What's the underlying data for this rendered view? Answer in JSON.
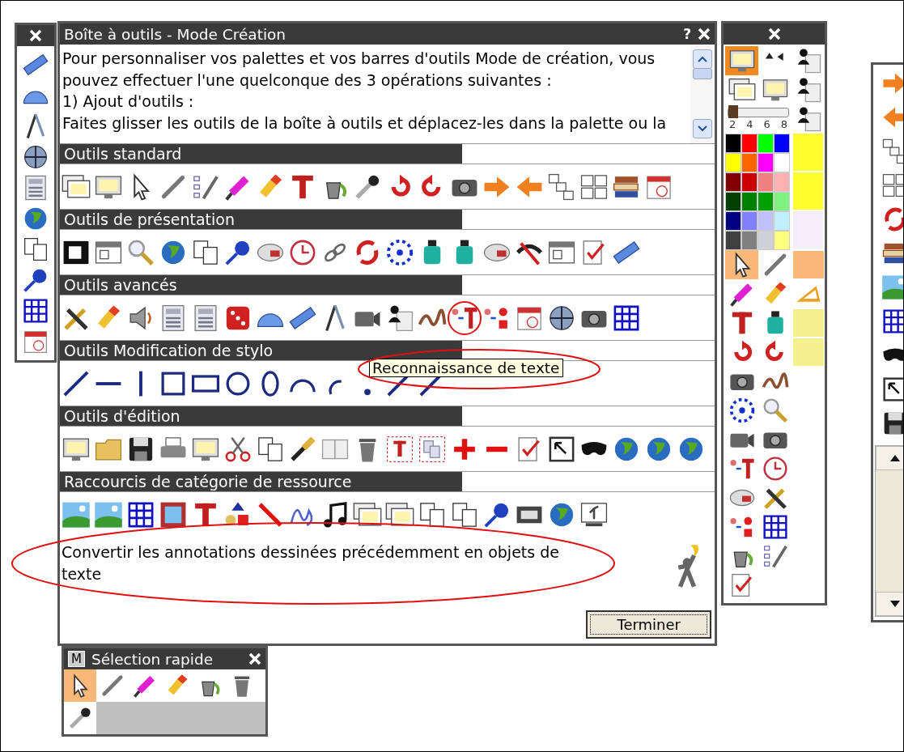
{
  "toolbox": {
    "title": "Boîte à outils - Mode Création",
    "help": "?",
    "intro_lines": [
      "Pour personnaliser vos palettes et vos barres d'outils Mode de création, vous",
      "pouvez effectuer l'une quelconque des 3 opérations suivantes :",
      "1) Ajout d'outils :",
      "Faites glisser les outils de la boîte à outils et déplacez-les dans la palette ou la"
    ],
    "sections": [
      {
        "title": "Outils standard"
      },
      {
        "title": "Outils de présentation"
      },
      {
        "title": "Outils avancés"
      },
      {
        "title": "Outils Modification de stylo"
      },
      {
        "title": "Outils d'édition"
      },
      {
        "title": "Raccourcis de catégorie de ressource"
      }
    ],
    "tooltip": "Reconnaissance de texte",
    "description": "Convertir les annotations dessinées précédemment en objets de\ntexte",
    "button": "Terminer"
  },
  "pen_palette": {
    "mode_button": {
      "selected": true
    },
    "width_slider": {
      "level": 0,
      "labels": [
        "2",
        "4",
        "6",
        "8"
      ]
    },
    "swatches": [
      {
        "color": "#000000"
      },
      {
        "color": "#ff0000"
      },
      {
        "color": "#00ff00"
      },
      {
        "color": "#0000ff"
      },
      {
        "color": "#ffff00"
      },
      {
        "color": "#ff6600"
      },
      {
        "color": "#ff00ff"
      },
      {
        "color": "#ffffff"
      },
      {
        "color": "#800000"
      },
      {
        "color": "#cc0000"
      },
      {
        "color": "#f08080"
      },
      {
        "color": "#ffb0b0"
      },
      {
        "color": "#004000"
      },
      {
        "color": "#008000"
      },
      {
        "color": "#00a000"
      },
      {
        "color": "#80f080"
      },
      {
        "color": "#000080"
      },
      {
        "color": "#8080ff"
      },
      {
        "color": "#c0c0ff"
      },
      {
        "color": "#c0f0ff"
      },
      {
        "color": "#404040"
      },
      {
        "color": "#808080"
      },
      {
        "color": "#d0d0d8"
      },
      {
        "color": "#ffff80"
      }
    ],
    "tools": [
      {
        "selected": true
      },
      {
        "selected": false
      },
      {
        "selected": false
      },
      {
        "selected": false
      },
      {
        "selected": false
      },
      {
        "selected": false
      },
      {
        "selected": false
      },
      {
        "selected": false
      },
      {
        "selected": false
      },
      {
        "selected": false
      },
      {
        "selected": false
      },
      {
        "selected": false
      },
      {
        "selected": false
      },
      {
        "selected": false
      },
      {
        "selected": false
      },
      {
        "selected": false
      },
      {
        "selected": false
      },
      {
        "selected": false
      },
      {
        "selected": false
      },
      {
        "selected": false
      },
      {
        "selected": false
      },
      {
        "selected": false
      },
      {
        "selected": false
      },
      {
        "selected": false
      }
    ]
  },
  "quick_select": {
    "badge": "M",
    "title": "Sélection rapide",
    "tools": [
      {
        "selected": true
      },
      {
        "selected": false
      },
      {
        "selected": false
      },
      {
        "selected": false
      },
      {
        "selected": false
      },
      {
        "selected": false
      },
      {
        "selected": false
      }
    ]
  }
}
